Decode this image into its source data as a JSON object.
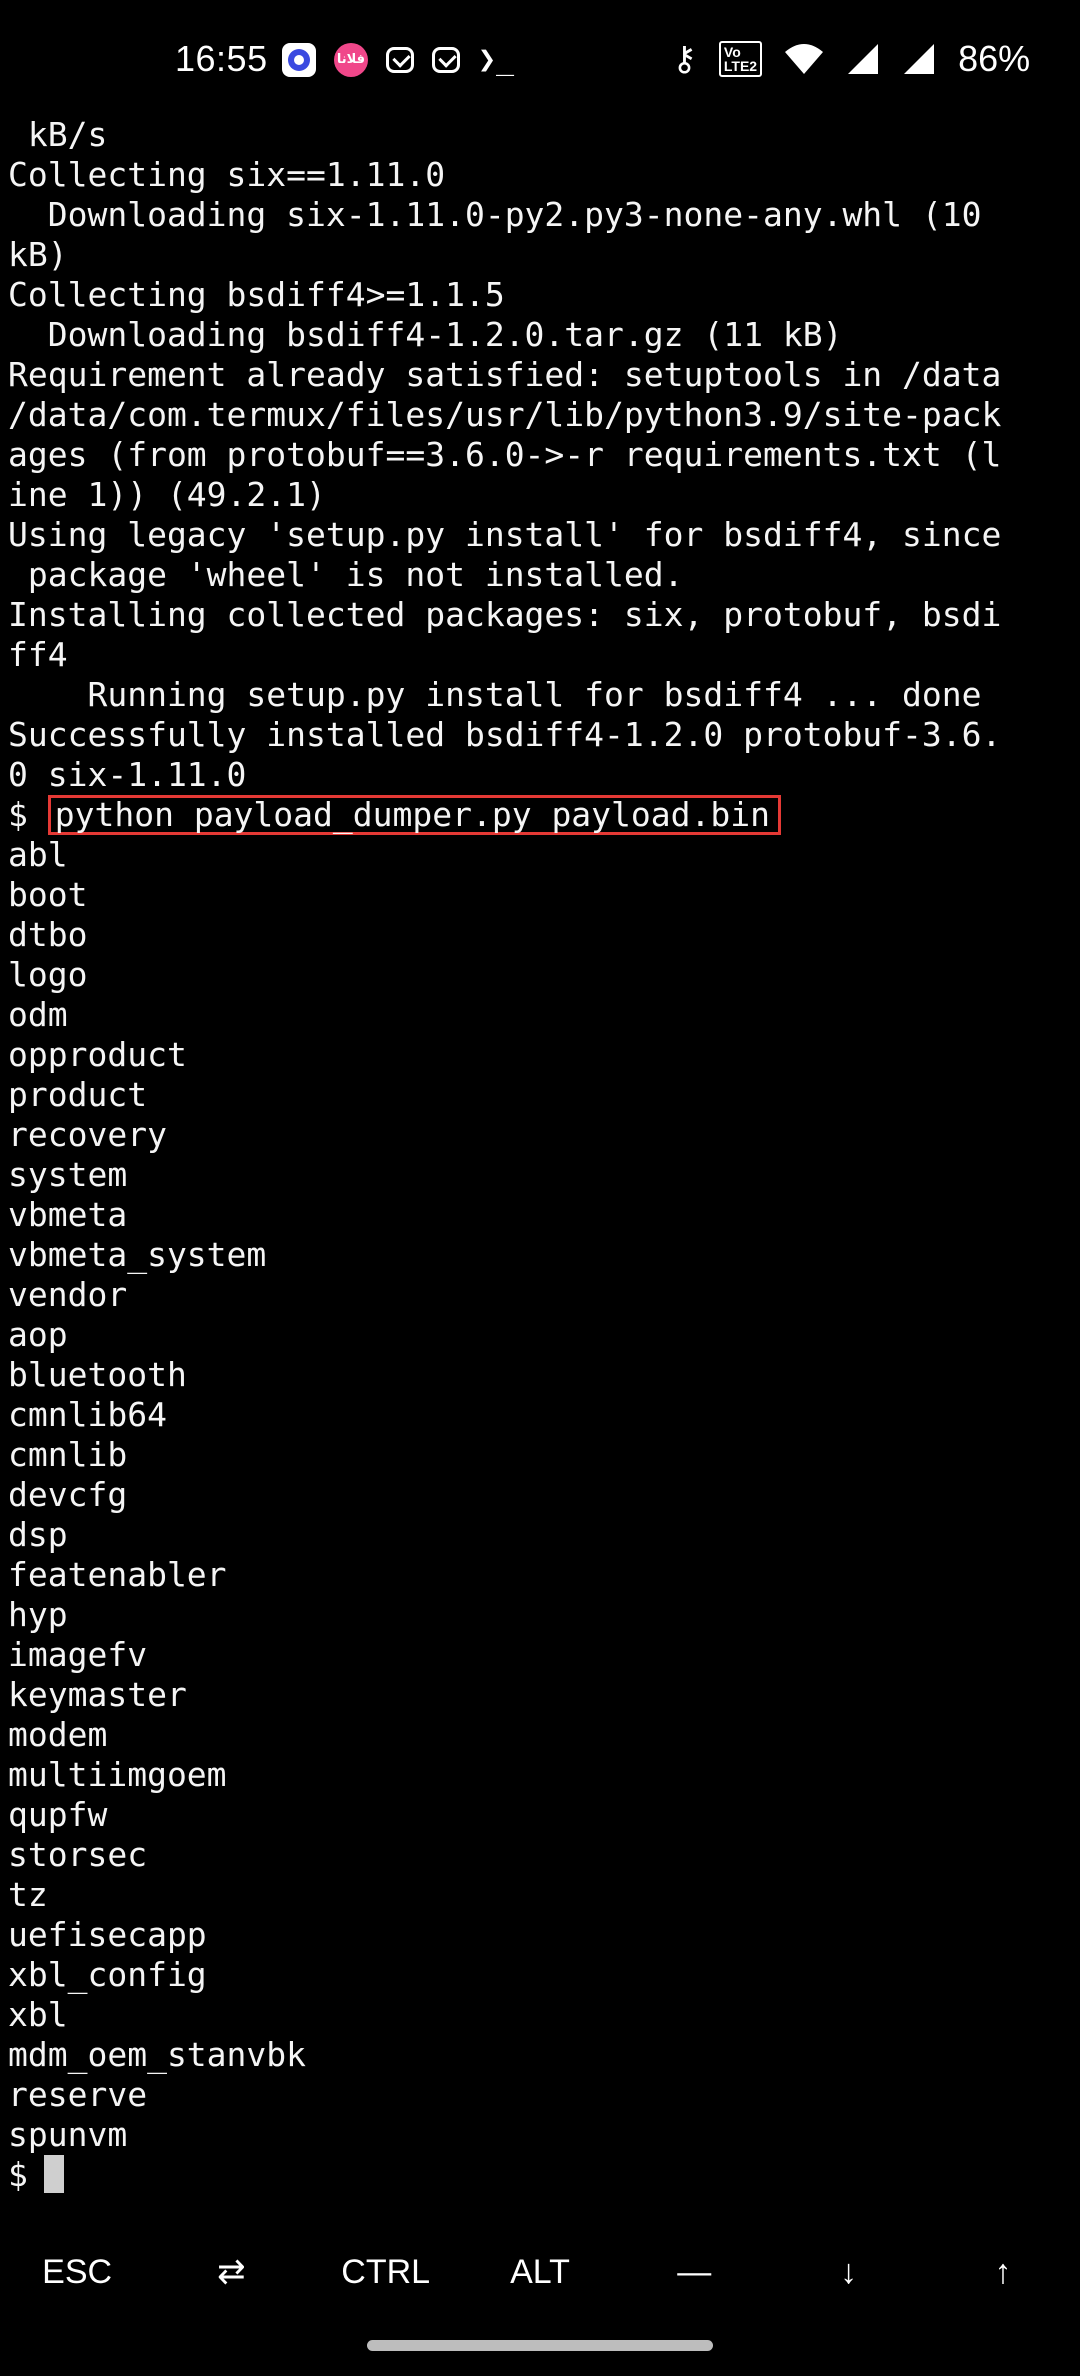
{
  "status_bar": {
    "time": "16:55",
    "notif_pink_label": "فلانا",
    "terminal_glyph": "❯_",
    "key_glyph": "⚷",
    "lte_line1": "Vo",
    "lte_line2": "LTE2",
    "battery": "86%",
    "icons": [
      "app-notification-icon",
      "pink-app-icon",
      "mail-icon",
      "mail-icon",
      "terminal-icon",
      "key-icon",
      "volte-icon",
      "wifi-icon",
      "signal-icon",
      "signal-icon"
    ]
  },
  "terminal": {
    "lines": [
      " kB/s",
      "Collecting six==1.11.0",
      "  Downloading six-1.11.0-py2.py3-none-any.whl (10",
      "kB)",
      "Collecting bsdiff4>=1.1.5",
      "  Downloading bsdiff4-1.2.0.tar.gz (11 kB)",
      "Requirement already satisfied: setuptools in /data",
      "/data/com.termux/files/usr/lib/python3.9/site-pack",
      "ages (from protobuf==3.6.0->-r requirements.txt (l",
      "ine 1)) (49.2.1)",
      "Using legacy 'setup.py install' for bsdiff4, since",
      " package 'wheel' is not installed.",
      "Installing collected packages: six, protobuf, bsdi",
      "ff4",
      "    Running setup.py install for bsdiff4 ... done",
      "Successfully installed bsdiff4-1.2.0 protobuf-3.6.",
      "0 six-1.11.0"
    ],
    "prompt": "$",
    "command": "python payload_dumper.py payload.bin",
    "partitions": [
      "abl",
      "boot",
      "dtbo",
      "logo",
      "odm",
      "opproduct",
      "product",
      "recovery",
      "system",
      "vbmeta",
      "vbmeta_system",
      "vendor",
      "aop",
      "bluetooth",
      "cmnlib64",
      "cmnlib",
      "devcfg",
      "dsp",
      "featenabler",
      "hyp",
      "imagefv",
      "keymaster",
      "modem",
      "multiimgoem",
      "qupfw",
      "storsec",
      "tz",
      "uefisecapp",
      "xbl_config",
      "xbl",
      "mdm_oem_stanvbk",
      "reserve",
      "spunvm"
    ],
    "final_prompt": "$"
  },
  "extra_keys": [
    "ESC",
    "⇄",
    "CTRL",
    "ALT",
    "—",
    "↓",
    "↑"
  ],
  "colors": {
    "background": "#000000",
    "text": "#f5f5f5",
    "highlight_border": "#e53935",
    "cursor": "#cfcfcf"
  }
}
